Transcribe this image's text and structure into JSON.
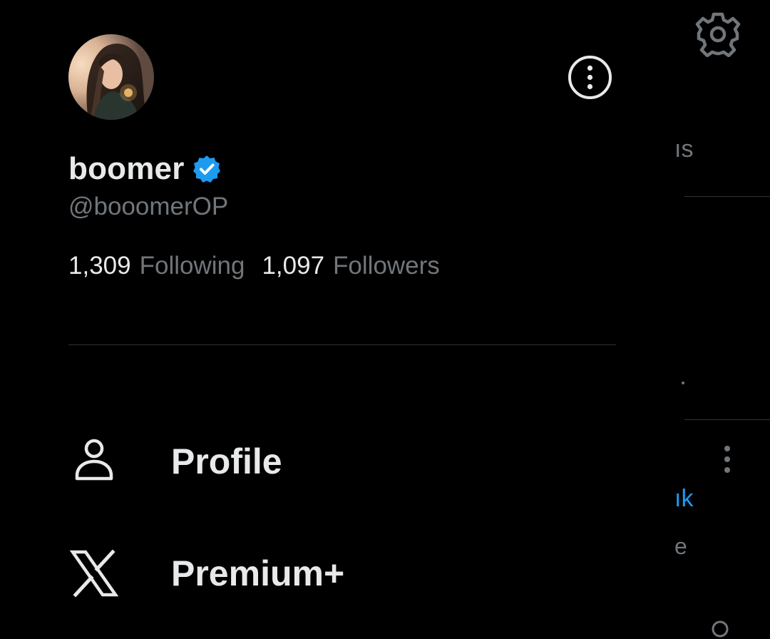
{
  "drawer": {
    "user": {
      "display_name": "boomer",
      "handle": "@booomerOP",
      "verified": true,
      "verified_color": "#1d9bf0"
    },
    "stats": [
      {
        "count": "1,309",
        "label": "Following"
      },
      {
        "count": "1,097",
        "label": "Followers"
      }
    ],
    "menu": [
      {
        "label": "Profile",
        "icon": "person-icon"
      },
      {
        "label": "Premium+",
        "icon": "x-logo-icon"
      }
    ]
  },
  "background_feed": {
    "tab_fragment": "ıs",
    "link_fragment": "ık",
    "text_fragment": "e"
  },
  "colors": {
    "background": "#000000",
    "primary_text": "#e7e9ea",
    "secondary_text": "#71767b",
    "divider": "#2f3336",
    "accent": "#1d9bf0"
  }
}
